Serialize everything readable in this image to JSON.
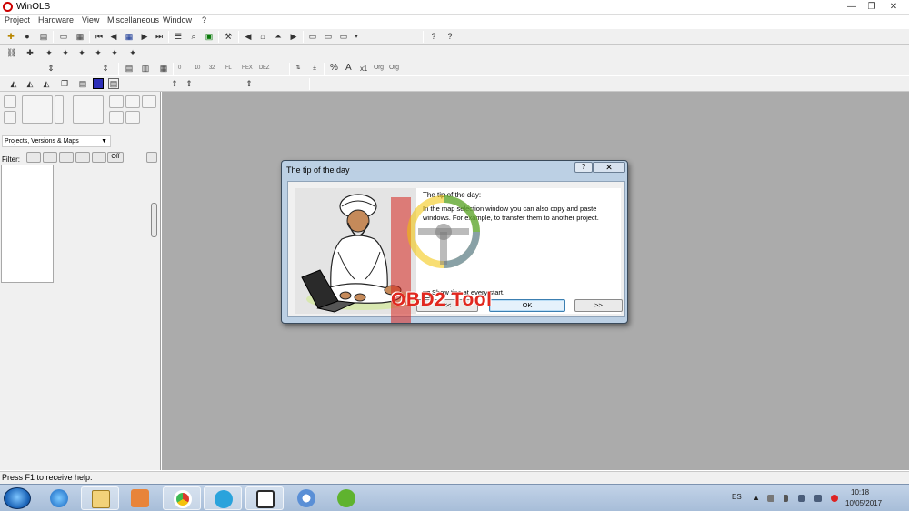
{
  "window": {
    "title": "WinOLS",
    "controls": {
      "minimize": "—",
      "restore": "❐",
      "close": "✕"
    }
  },
  "menu": [
    "Project",
    "Hardware",
    "View",
    "Miscellaneous",
    "Window",
    "?"
  ],
  "toolbar2": {
    "texts": [
      "0",
      "10",
      "32",
      "FL",
      "HEX",
      "DEZ",
      "%",
      "A",
      "x1",
      "Org",
      "Org"
    ]
  },
  "left_panel": {
    "project_select": "Projects, Versions & Maps",
    "filter_label": "Filter:",
    "filter_off": "Off"
  },
  "status": "Press F1 to receive help.",
  "dialog": {
    "title": "The tip of the day",
    "help_button": "?",
    "close_button": "✕",
    "tip_heading": "The tip of the day:",
    "tip_text": "In the map selection window you can also copy and paste windows. For example, to transfer them to another project.",
    "checkbox_label": "Show tips at every start.",
    "checkbox_mark": "✓",
    "buttons": {
      "ok": "OK",
      "next": ">>",
      "back": "<<"
    }
  },
  "watermark": "OBD2 Tool",
  "taskbar": {
    "apps": [
      "internet-explorer-icon",
      "file-explorer-icon",
      "media-player-icon",
      "chrome-icon",
      "telegram-icon",
      "winols-icon",
      "chrome-alt-icon",
      "utorrent-icon"
    ],
    "tray": {
      "language": "ES",
      "time": "10:18",
      "date": "10/05/2017"
    }
  }
}
